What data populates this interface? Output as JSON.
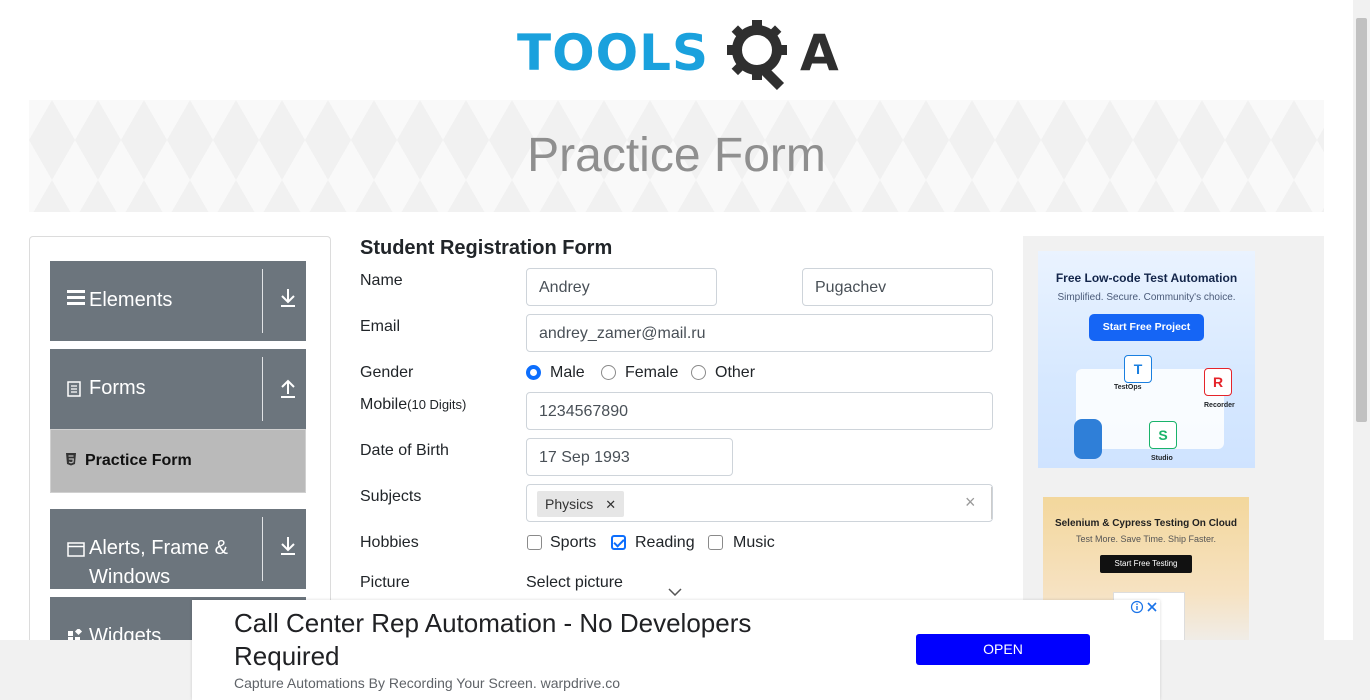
{
  "header": {
    "logo_tools": "TOOLS",
    "logo_qa": "QA"
  },
  "banner": {
    "title": "Practice Form"
  },
  "sidebar": {
    "groups": [
      {
        "label": "Elements",
        "icon": "hamburger-icon",
        "arrow": "download-icon"
      },
      {
        "label": "Forms",
        "icon": "document-icon",
        "arrow": "upload-icon"
      },
      {
        "label": "Alerts, Frame & Windows",
        "icon": "window-icon",
        "arrow": "download-icon"
      },
      {
        "label": "Widgets",
        "icon": "widgets-icon",
        "arrow": "download-icon"
      }
    ],
    "active_item": {
      "label": "Practice Form",
      "icon": "html5-icon"
    }
  },
  "form": {
    "title": "Student Registration Form",
    "labels": {
      "name": "Name",
      "email": "Email",
      "gender": "Gender",
      "mobile": "Mobile",
      "mobile_hint": "(10 Digits)",
      "dob": "Date of Birth",
      "subjects": "Subjects",
      "hobbies": "Hobbies",
      "picture": "Picture"
    },
    "first_name": "Andrey",
    "last_name": "Pugachev",
    "email": "andrey_zamer@mail.ru",
    "gender_options": [
      "Male",
      "Female",
      "Other"
    ],
    "gender_selected": "Male",
    "mobile": "1234567890",
    "dob": "17 Sep 1993",
    "subjects": [
      "Physics"
    ],
    "hobby_options": [
      "Sports",
      "Reading",
      "Music"
    ],
    "hobbies_selected": [
      "Reading"
    ],
    "picture_button": "Select picture"
  },
  "ads": {
    "right1": {
      "title": "Free Low-code Test Automation",
      "subtitle": "Simplified. Secure. Community's choice.",
      "cta": "Start Free Project",
      "labels": [
        "TestOps",
        "Recorder",
        "Studio"
      ]
    },
    "right2": {
      "title": "Selenium & Cypress Testing On Cloud",
      "subtitle": "Test More. Save Time. Ship Faster.",
      "cta": "Start Free Testing"
    },
    "bottom": {
      "headline": "Call Center Rep Automation - No Developers Required",
      "sub": "Capture Automations By Recording Your Screen. warpdrive.co",
      "cta": "OPEN"
    }
  }
}
